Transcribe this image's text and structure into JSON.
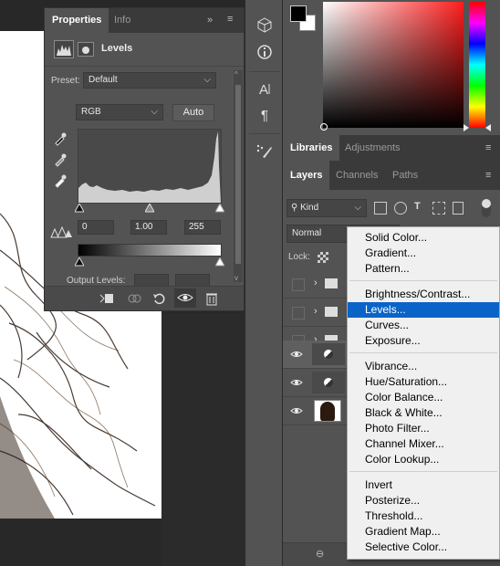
{
  "properties": {
    "tab_active": "Properties",
    "tab_inactive": "Info",
    "collapse": "»",
    "adjustment_title": "Levels",
    "preset_label": "Preset:",
    "preset_value": "Default",
    "channel_value": "RGB",
    "auto_label": "Auto",
    "input_black": "0",
    "input_mid": "1.00",
    "input_white": "255",
    "output_label": "Output Levels:"
  },
  "right_tabs": {
    "libraries": "Libraries",
    "adjustments": "Adjustments",
    "layers": "Layers",
    "channels": "Channels",
    "paths": "Paths"
  },
  "layers": {
    "kind_label": "Kind",
    "blend_mode": "Normal",
    "lock_label": "Lock:"
  },
  "menu": {
    "group1": [
      "Solid Color...",
      "Gradient...",
      "Pattern..."
    ],
    "group2": [
      "Brightness/Contrast...",
      "Levels...",
      "Curves...",
      "Exposure..."
    ],
    "group3": [
      "Vibrance...",
      "Hue/Saturation...",
      "Color Balance...",
      "Black & White...",
      "Photo Filter...",
      "Channel Mixer...",
      "Color Lookup..."
    ],
    "group4": [
      "Invert",
      "Posterize...",
      "Threshold...",
      "Gradient Map...",
      "Selective Color..."
    ],
    "selected": "Levels..."
  },
  "colors": {
    "panel": "#535353",
    "dark": "#3a3a3a",
    "accent_highlight": "#0a64c8",
    "foreground": "#000000",
    "background": "#ffffff"
  }
}
